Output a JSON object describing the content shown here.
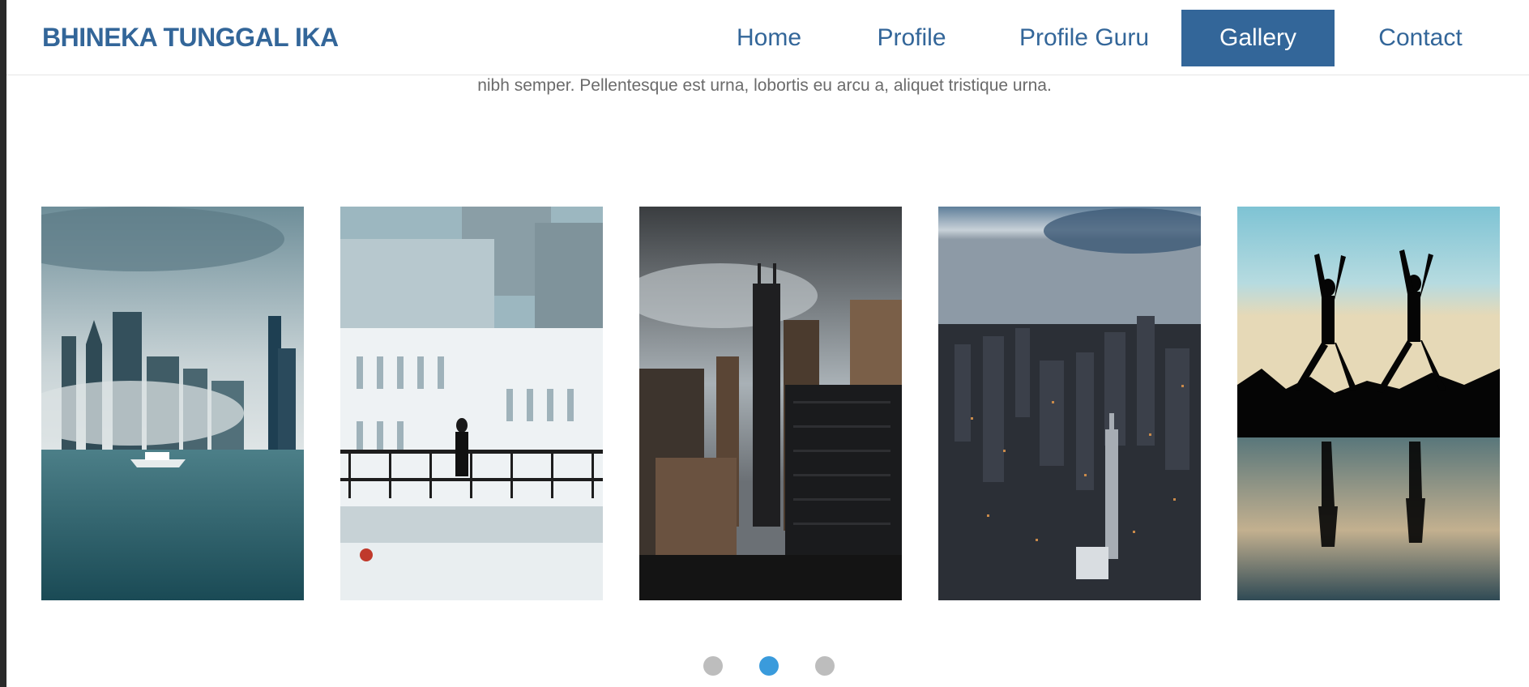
{
  "brand": {
    "title": "BHINEKA TUNGGAL IKA",
    "color": "#336699"
  },
  "nav": {
    "items": [
      {
        "label": "Home",
        "active": false
      },
      {
        "label": "Profile",
        "active": false
      },
      {
        "label": "Profile Guru",
        "active": false
      },
      {
        "label": "Gallery",
        "active": true
      },
      {
        "label": "Contact",
        "active": false
      }
    ],
    "active_color": "#336699"
  },
  "gallery": {
    "intro_text": "nibh semper. Pellentesque est urna, lobortis eu arcu a, aliquet tristique urna.",
    "images": [
      {
        "icon": "city-skyline-water-image"
      },
      {
        "icon": "white-building-balcony-image"
      },
      {
        "icon": "skyscrapers-sky-image"
      },
      {
        "icon": "aerial-city-dusk-image"
      },
      {
        "icon": "yoga-silhouettes-sunset-image"
      }
    ],
    "pagination": {
      "count": 3,
      "active_index": 1,
      "active_color": "#3a9bdc",
      "inactive_color": "#bdbdbd"
    }
  }
}
